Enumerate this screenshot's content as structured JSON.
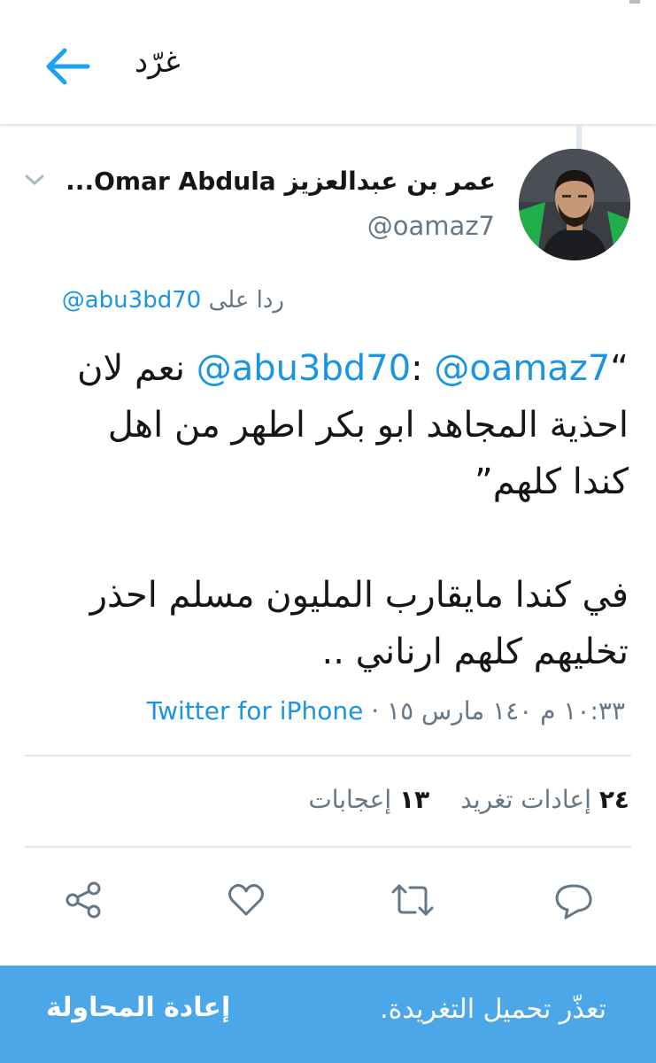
{
  "header": {
    "title": "غرّد"
  },
  "tweet": {
    "author_name": "عمر بن عبدالعزيز Omar Abdula...",
    "author_handle": "@oamaz7",
    "reply_prefix": "ردا على",
    "reply_to": "@abu3bd70",
    "text": {
      "quote_open": "“",
      "mention_1": "@abu3bd70",
      "sep": ": ",
      "mention_2": "@oamaz7",
      "line_1_rest": " نعم لان احذية المجاهد ابو بكر اطهر من اهل كندا كلهم”",
      "paragraph_2": "في كندا مايقارب المليون مسلم احذر تخليهم كلهم ارناني .."
    },
    "timestamp": "١٠:٣٣ م ١٤٠ مارس ١٥",
    "dot": " · ",
    "source": "Twitter for iPhone",
    "retweets_count": "٢٤",
    "retweets_label": "إعادات تغريد",
    "likes_count": "١٣",
    "likes_label": "إعجابات"
  },
  "banner": {
    "message": "تعذّر تحميل التغريدة.",
    "retry_label": "إعادة المحاولة"
  },
  "icons": {
    "back": "arrow-left-icon",
    "caret": "chevron-down-icon",
    "share": "share-icon",
    "like": "heart-icon",
    "retweet": "retweet-icon",
    "reply": "reply-icon"
  },
  "colors": {
    "link": "#1b95e0",
    "banner": "#4ca7e8",
    "muted": "#657786",
    "icon": "#657786"
  }
}
